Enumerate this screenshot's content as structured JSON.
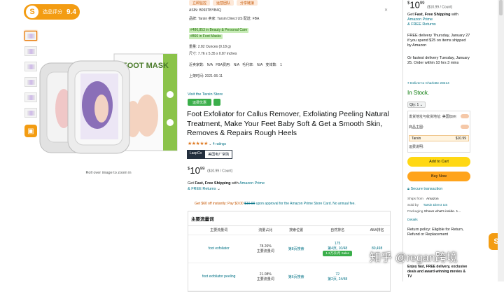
{
  "score": {
    "label": "选品评分",
    "value": "9.4",
    "icon": "S"
  },
  "zoom_hint": "Roll over image to zoom in",
  "top_tags": [
    "立即监控",
    "运营团队",
    "分享链接"
  ],
  "info": {
    "asin_line": "ASIN: B093TBYB4Q",
    "seller_line": "品牌: Tarsin    卖家: Tarsin Direct US    配送: FBA",
    "rank1": "#486,853 in Beauty & Personal Care",
    "rank2": "#866 in Foot Masks",
    "weight": "重量: 2.82 Ounces (0.18 g)",
    "dimensions": "尺寸: 7.76 x 5.35 x 0.87 inches",
    "sellers_line": "近卖家数: N/A      FBA费用: N/A      毛利率: N/A      变体数: 1",
    "date": "上架时间: 2021-06-11"
  },
  "store_link": "Visit the Tarsin Store",
  "prime_label": "运费优惠",
  "title": "Foot Exfoliator for Callus Remover, Exfoliating Peeling Natural Treatment, Make Your Feet Baby Soft & Get a Smooth Skin, Removes & Repairs Rough Heels",
  "rating": {
    "stars": "★★★★★",
    "count": "4 ratings"
  },
  "badges": {
    "brand": "LaspCo",
    "note": "美国电厂常购"
  },
  "price": {
    "symbol": "$",
    "dollars": "10",
    "cents": "99",
    "unit": "($10.99 / Count)"
  },
  "shipping": {
    "pre": "Get ",
    "bold": "Fast, Free Shipping",
    "mid": " with ",
    "link": "Amazon Prime",
    "returns": "& FREE Returns"
  },
  "promo": {
    "text": "Get $60 off instantly: Pay $0.00 ",
    "strike": "$10.99",
    "rest": " upon approval for the Amazon Prime Store Card. No annual fee."
  },
  "analysis": {
    "heading": "主要流量词",
    "columns": [
      "主要流量词",
      "流量占比",
      "搜索位置",
      "自然排名",
      "ABA排名"
    ],
    "rows": [
      {
        "keyword": "foot exfoliator",
        "share": "78.26%",
        "share_sub": "主要流量词",
        "position": "第8页搜索",
        "rank": "175",
        "rank_sub": "第4页, 10/48",
        "pill": "1.2万次/月 Sales",
        "aba": "80,498"
      },
      {
        "keyword": "foot exfoliator peeling",
        "share": "21.08%",
        "share_sub": "主要流量词",
        "position": "第6页搜索",
        "rank": "72",
        "rank_sub": "第2页, 24/48",
        "pill": "",
        "aba": ""
      }
    ]
  },
  "buybox": {
    "price": {
      "dollars": "10",
      "cents": "99",
      "unit": "($10.99 / Count)"
    },
    "shipping_pre": "Get ",
    "shipping_bold": "Fast, Free Shipping",
    "shipping_with": " with",
    "prime_link": "Amazon Prime",
    "returns": "& FREE Returns",
    "delivery": "FREE delivery Thursday, January 27 if you spend $25 on items shipped by Amazon",
    "fastest": "Or fastest delivery Tuesday, January 25. Order within 10 hrs 3 mins",
    "location": "Deliver to Charlotte 28214",
    "stock": "In Stock.",
    "qty": "Qty: 1",
    "opt1": "发货地址与收货地址: 美国加州",
    "opt2": "商品主图:",
    "opt3": "运费说明:",
    "sub_label": "Tarsin",
    "sub_value": "$10.99",
    "add_cart": "Add to Cart",
    "buy_now": "Buy Now",
    "secure": "Secure transaction",
    "ships_from_k": "Ships from",
    "ships_from_v": "Amazon",
    "sold_by_k": "Sold by",
    "sold_by_v": "Tarsin Direct US",
    "packaging_k": "Packaging",
    "packaging_v": "Shows what's inside. 1...",
    "details": "Details",
    "return_policy": "Return policy: Eligible for Return, Refund or Replacement",
    "promo_box": "Enjoy fast, FREE delivery, exclusive deals and award-winning movies & TV"
  },
  "watermark": "知乎 @regan跨境"
}
